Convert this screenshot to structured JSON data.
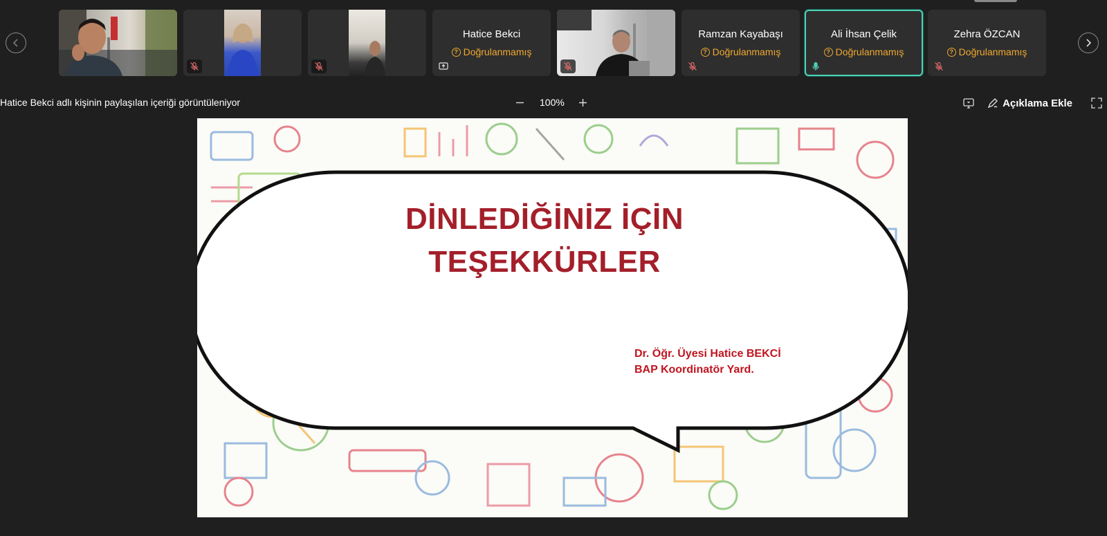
{
  "participants": [
    {
      "type": "video",
      "name": "",
      "mic": "none"
    },
    {
      "type": "video",
      "name": "",
      "mic": "off"
    },
    {
      "type": "video",
      "name": "",
      "mic": "off"
    },
    {
      "type": "avatar",
      "name": "Hatice Bekci",
      "status": "Doğrulanmamış",
      "badge": "share-screen-icon"
    },
    {
      "type": "video",
      "name": "",
      "mic": "off"
    },
    {
      "type": "avatar",
      "name": "Ramzan Kayabaşı",
      "status": "Doğrulanmamış",
      "mic": "off"
    },
    {
      "type": "avatar",
      "name": "Ali İhsan Çelik",
      "status": "Doğrulanmamış",
      "mic": "on",
      "speaking": true
    },
    {
      "type": "avatar",
      "name": "Zehra ÖZCAN",
      "status": "Doğrulanmamış",
      "mic": "off"
    }
  ],
  "share_bar": {
    "viewing_label": "Hatice Bekci adlı kişinin paylaşılan içeriği görüntüleniyor",
    "zoom": "100%",
    "annotate_label": "Açıklama Ekle"
  },
  "slide": {
    "title_line1": "DİNLEDİĞİNİZ İÇİN",
    "title_line2": "TEŞEKKÜRLER",
    "author_line1": "Dr. Öğr. Üyesi Hatice BEKCİ",
    "author_line2": "BAP Koordinatör Yard."
  },
  "colors": {
    "background": "#1f1f1f",
    "tile": "#2e2e2e",
    "warning": "#f0a830",
    "speaking_border": "#4fd1b5",
    "slide_title": "#a31f2a",
    "slide_author": "#c0141f"
  }
}
